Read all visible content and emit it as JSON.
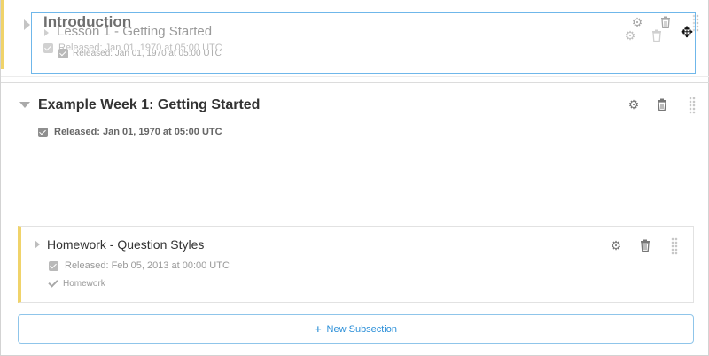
{
  "intro_section": {
    "title": "Introduction",
    "released": "Released: Jan 01, 1970 at 05:00 UTC"
  },
  "drag_ghost": {
    "title": "Lesson 1 - Getting Started",
    "released": "Released: Jan 01, 1970 at 05:00 UTC"
  },
  "week_section": {
    "title": "Example Week 1: Getting Started",
    "released": "Released: Jan 01, 1970 at 05:00 UTC"
  },
  "subsection": {
    "title": "Homework - Question Styles",
    "released": "Released: Feb 05, 2013 at 00:00 UTC",
    "grading": "Homework"
  },
  "new_subsection": {
    "label": "New Subsection",
    "icon": "+"
  },
  "icons": {
    "settings": "gear-icon",
    "delete": "trash-icon",
    "drag": "drag-handle-icon",
    "move_cursor": "move-cursor-icon"
  },
  "colors": {
    "accent_border": "#f0d36a",
    "link_blue": "#2b8fd8",
    "ghost_border": "#6fb7ea"
  }
}
